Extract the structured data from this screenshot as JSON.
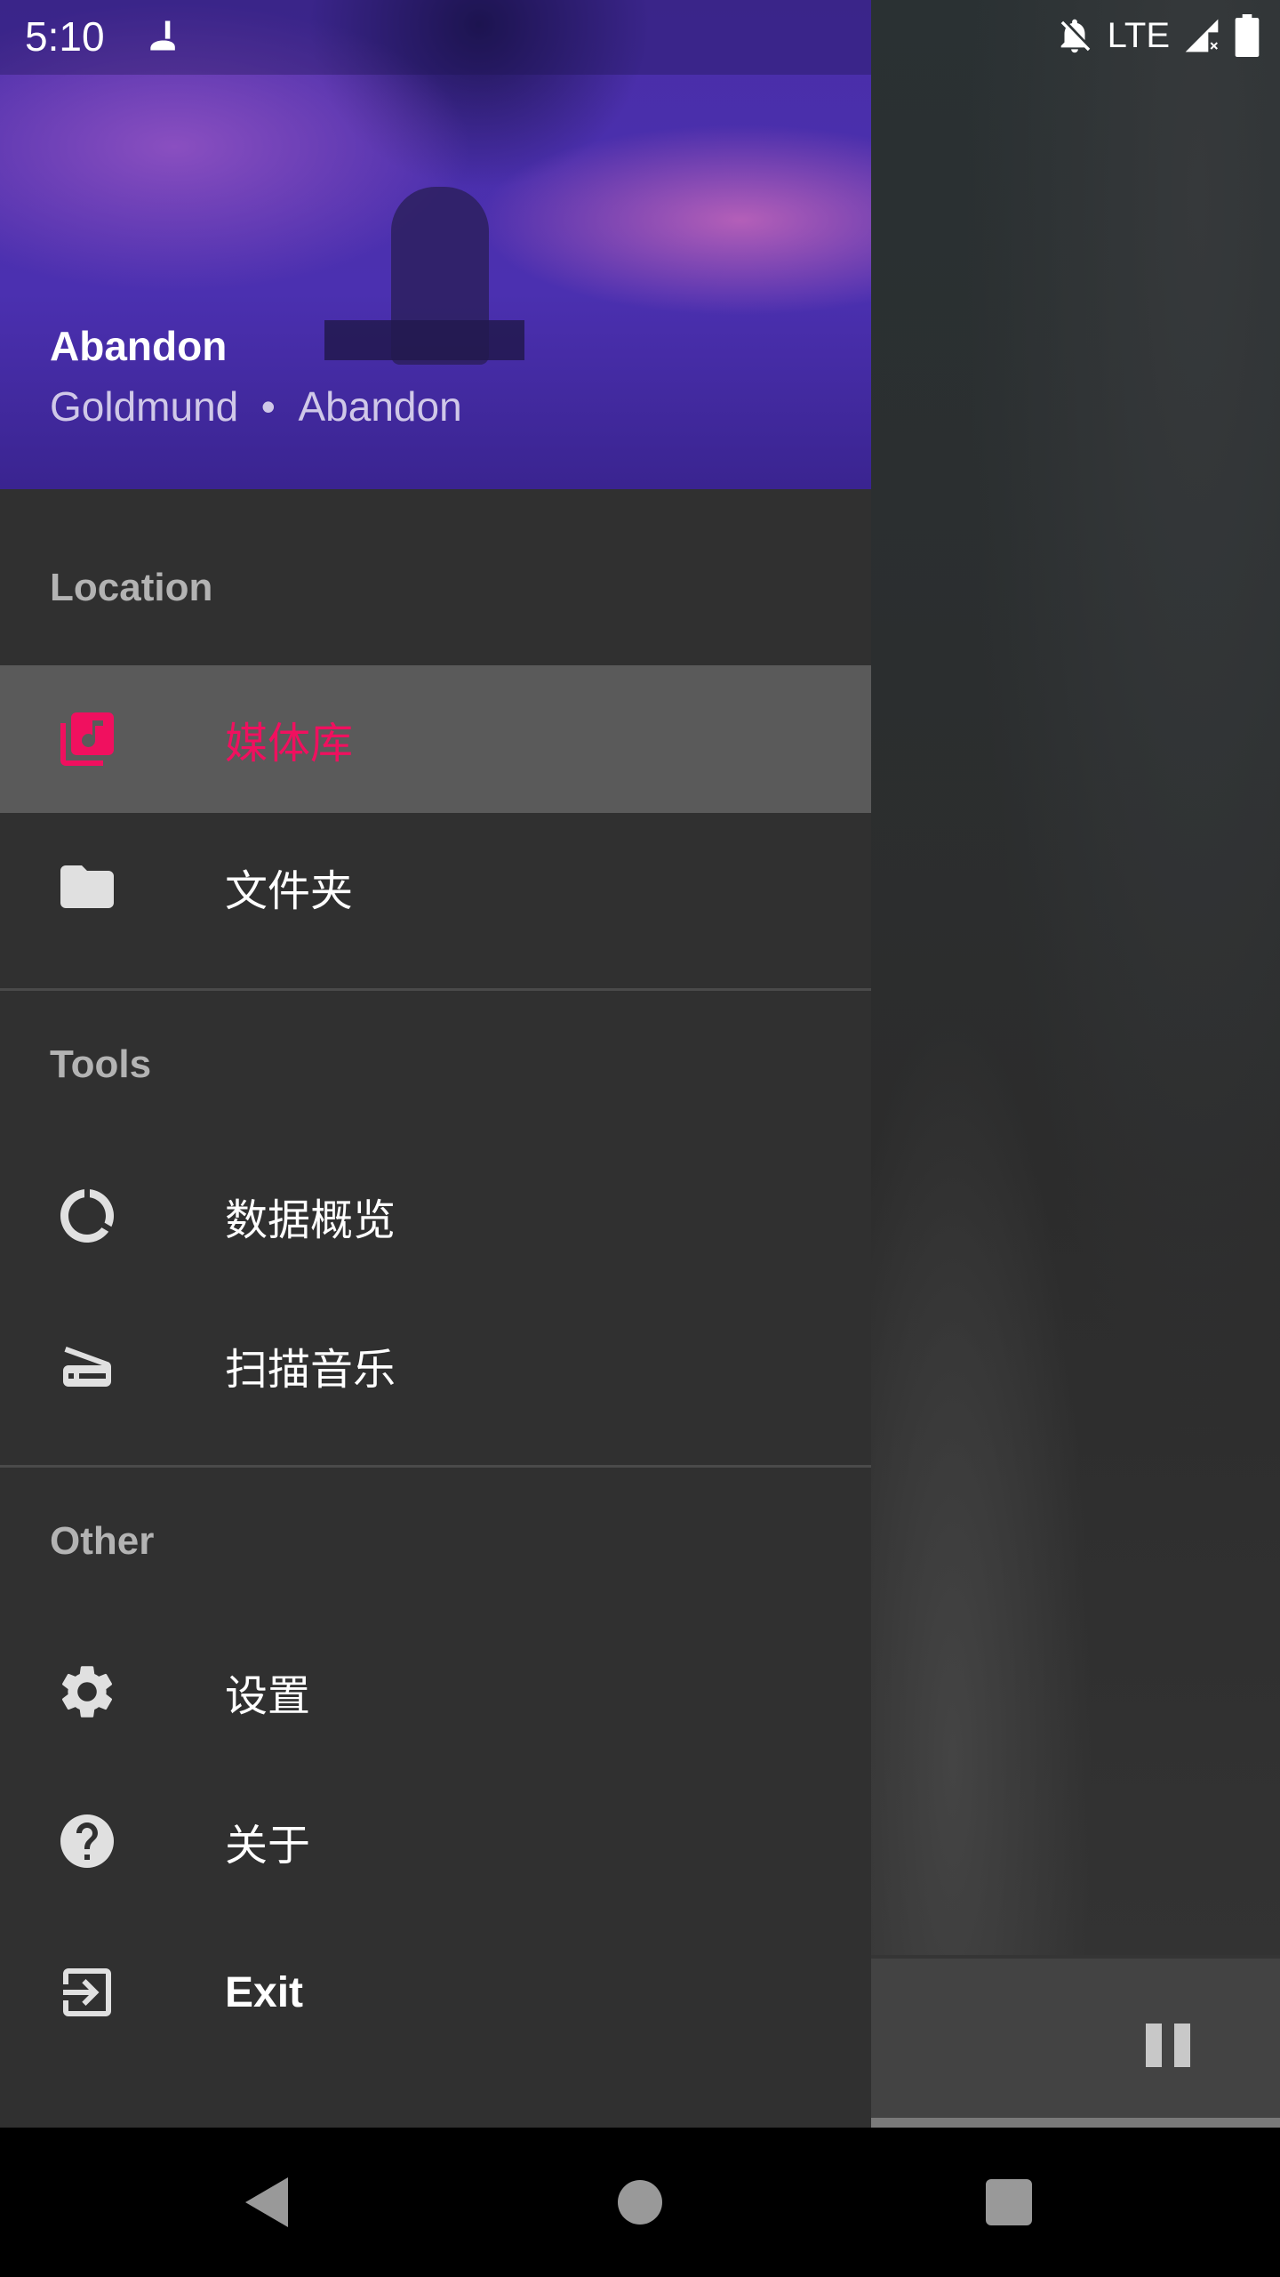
{
  "status_bar": {
    "time": "5:10",
    "network": "LTE"
  },
  "now_playing": {
    "title": "Abandon",
    "artist": "Goldmund",
    "separator": "•",
    "album": "Abandon"
  },
  "sections": {
    "location": {
      "label": "Location",
      "items": [
        {
          "label": "媒体库",
          "icon": "library-music-icon",
          "selected": true
        },
        {
          "label": "文件夹",
          "icon": "folder-icon"
        }
      ]
    },
    "tools": {
      "label": "Tools",
      "items": [
        {
          "label": "数据概览",
          "icon": "donut-chart-icon"
        },
        {
          "label": "扫描音乐",
          "icon": "scanner-icon"
        }
      ]
    },
    "other": {
      "label": "Other",
      "items": [
        {
          "label": "设置",
          "icon": "gear-icon"
        },
        {
          "label": "关于",
          "icon": "help-icon"
        },
        {
          "label": "Exit",
          "icon": "exit-icon"
        }
      ]
    }
  },
  "colors": {
    "accent": "#f0105f",
    "drawer": "#303030",
    "selected": "#5a5a5a"
  }
}
